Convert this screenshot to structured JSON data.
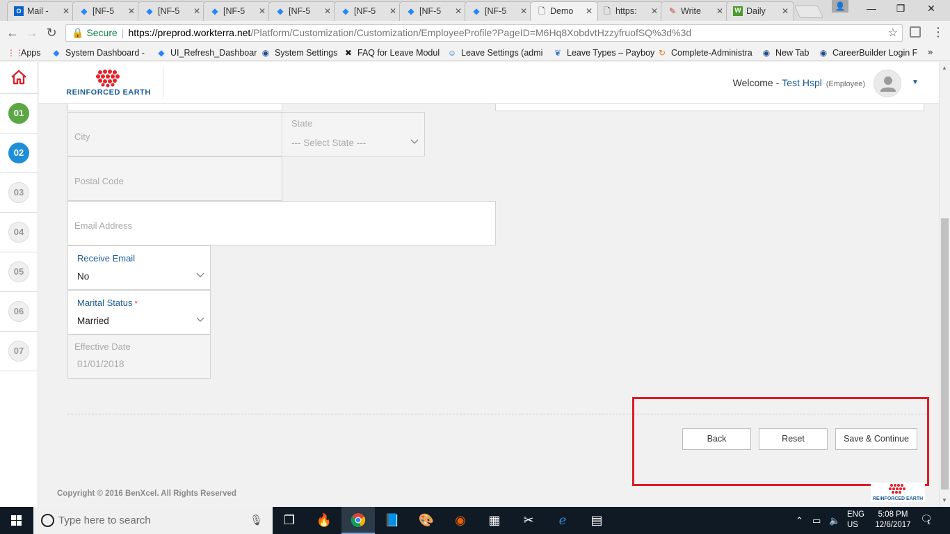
{
  "browser": {
    "tabs": [
      {
        "label": "Mail -",
        "icon": "outlook-icon",
        "active": false
      },
      {
        "label": "[NF-5",
        "icon": "jira-icon",
        "active": false
      },
      {
        "label": "[NF-5",
        "icon": "jira-icon",
        "active": false
      },
      {
        "label": "[NF-5",
        "icon": "jira-icon",
        "active": false
      },
      {
        "label": "[NF-5",
        "icon": "jira-icon",
        "active": false
      },
      {
        "label": "[NF-5",
        "icon": "jira-icon",
        "active": false
      },
      {
        "label": "[NF-5",
        "icon": "jira-icon",
        "active": false
      },
      {
        "label": "[NF-5",
        "icon": "jira-icon",
        "active": false
      },
      {
        "label": "Demo",
        "icon": "document-icon",
        "active": true
      },
      {
        "label": "https:",
        "icon": "document-icon",
        "active": false
      },
      {
        "label": "Write",
        "icon": "write-icon",
        "active": false
      },
      {
        "label": "Daily",
        "icon": "w-icon",
        "active": false
      }
    ],
    "secure_label": "Secure",
    "url_host": "https://preprod.workterra.net",
    "url_path": "/Platform/Customization/Customization/EmployeeProfile?PageID=M6Hq8XobdvtHzzyfruofSQ%3d%3d",
    "bookmarks": [
      {
        "label": "Apps",
        "icon": "apps-grid-icon"
      },
      {
        "label": "System Dashboard - ",
        "icon": "jira-icon"
      },
      {
        "label": "UI_Refresh_Dashboar",
        "icon": "jira-icon"
      },
      {
        "label": "System Settings",
        "icon": "globe-icon"
      },
      {
        "label": "FAQ for Leave Modul",
        "icon": "tools-icon"
      },
      {
        "label": "Leave Settings (admi",
        "icon": "person-icon"
      },
      {
        "label": "Leave Types – Payboy",
        "icon": "leaf-icon"
      },
      {
        "label": "Complete-Administra",
        "icon": "refresh-icon"
      },
      {
        "label": "New Tab",
        "icon": "globe-icon"
      },
      {
        "label": "CareerBuilder Login F",
        "icon": "globe-icon"
      }
    ],
    "bookmarks_more": "»"
  },
  "header": {
    "welcome_prefix": "Welcome -",
    "user_name": "Test Hspl",
    "user_role": "(Employee)"
  },
  "steps": [
    "01",
    "02",
    "03",
    "04",
    "05",
    "06",
    "07"
  ],
  "form": {
    "city": {
      "placeholder": "City"
    },
    "state": {
      "label": "State",
      "value": "--- Select State ---"
    },
    "postal_code": {
      "placeholder": "Postal Code"
    },
    "email": {
      "placeholder": "Email Address"
    },
    "receive_email": {
      "label": "Receive Email",
      "value": "No"
    },
    "marital_status": {
      "label": "Marital Status",
      "required_mark": "*",
      "value": "Married"
    },
    "effective_date": {
      "label": "Effective Date",
      "value": "01/01/2018"
    }
  },
  "buttons": {
    "back": "Back",
    "reset": "Reset",
    "save_continue": "Save & Continue"
  },
  "footer": {
    "copyright": "Copyright © 2016 BenXcel. All Rights Reserved"
  },
  "taskbar": {
    "search_placeholder": "Type here to search",
    "lang_line1": "ENG",
    "lang_line2": "US",
    "time": "5:08 PM",
    "date": "12/6/2017",
    "notification_count": "1"
  },
  "colors": {
    "accent_blue": "#1a5c96",
    "step_done": "#5aa744",
    "step_current": "#1e8fd6",
    "highlight_red": "#e01b24",
    "home_red": "#d7262c",
    "logo_red": "#e3232b"
  }
}
